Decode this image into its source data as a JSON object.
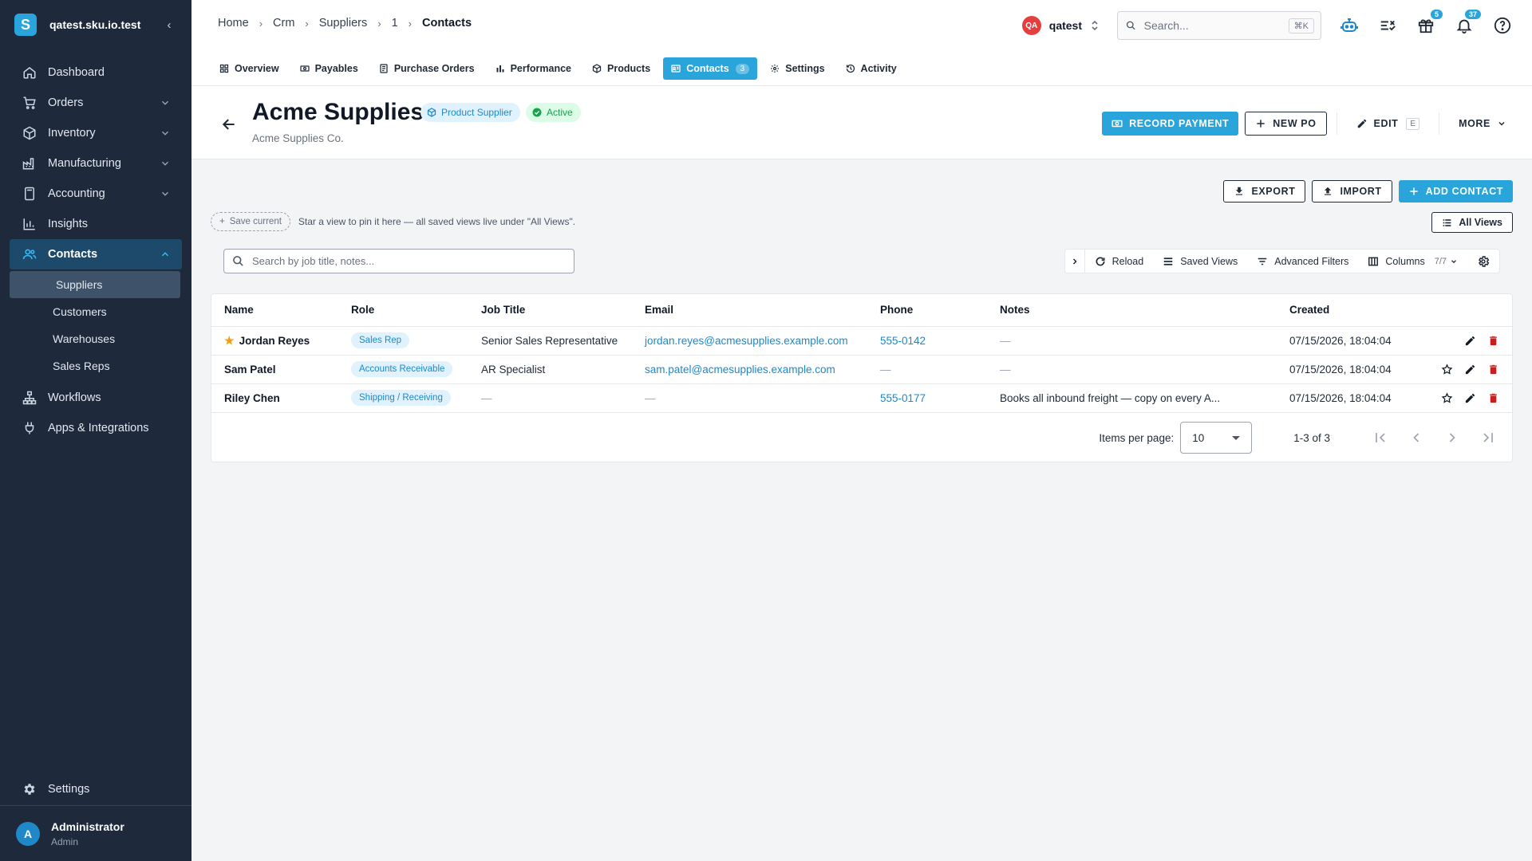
{
  "app": {
    "org_name": "qatest.sku.io.test",
    "logo_letter": "S",
    "brand_color": "#2aa5dc"
  },
  "sidebar": {
    "items": [
      {
        "label": "Dashboard",
        "icon": "home-icon"
      },
      {
        "label": "Orders",
        "icon": "cart-icon",
        "expandable": true
      },
      {
        "label": "Inventory",
        "icon": "box-icon",
        "expandable": true
      },
      {
        "label": "Manufacturing",
        "icon": "factory-icon",
        "expandable": true
      },
      {
        "label": "Accounting",
        "icon": "calculator-icon",
        "expandable": true
      },
      {
        "label": "Insights",
        "icon": "bar-chart-icon"
      },
      {
        "label": "Contacts",
        "icon": "people-icon",
        "expandable": true,
        "expanded": true,
        "active": true
      },
      {
        "label": "Workflows",
        "icon": "workflow-icon"
      },
      {
        "label": "Apps & Integrations",
        "icon": "plug-icon"
      }
    ],
    "contacts_sub": [
      {
        "label": "Suppliers",
        "active": true
      },
      {
        "label": "Customers"
      },
      {
        "label": "Warehouses"
      },
      {
        "label": "Sales Reps"
      }
    ],
    "settings_label": "Settings",
    "user": {
      "initial": "A",
      "name": "Administrator",
      "role": "Admin"
    }
  },
  "breadcrumb": [
    "Home",
    "Crm",
    "Suppliers",
    "1",
    "Contacts"
  ],
  "topbar": {
    "workspace_initials": "QA",
    "workspace_name": "qatest",
    "search_placeholder": "Search...",
    "search_shortcut": "⌘K",
    "gift_count": "5",
    "notification_count": "37"
  },
  "tabs": [
    {
      "label": "Overview",
      "icon": "grid-icon"
    },
    {
      "label": "Payables",
      "icon": "money-icon"
    },
    {
      "label": "Purchase Orders",
      "icon": "document-icon"
    },
    {
      "label": "Performance",
      "icon": "bar-chart-icon"
    },
    {
      "label": "Products",
      "icon": "cube-icon"
    },
    {
      "label": "Contacts",
      "icon": "contact-card-icon",
      "active": true,
      "count": "3"
    },
    {
      "label": "Settings",
      "icon": "gear-icon"
    },
    {
      "label": "Activity",
      "icon": "history-icon"
    }
  ],
  "supplier": {
    "name": "Acme Supplies",
    "legal_name": "Acme Supplies Co.",
    "type_badge": "Product Supplier",
    "status_badge": "Active"
  },
  "header_actions": {
    "record_payment": "RECORD PAYMENT",
    "new_po": "NEW PO",
    "edit": "EDIT",
    "edit_shortcut": "E",
    "more": "MORE"
  },
  "list_actions": {
    "export": "EXPORT",
    "import": "IMPORT",
    "add_contact": "ADD CONTACT"
  },
  "views": {
    "save_current": "Save current",
    "hint": "Star a view to pin it here — all saved views live under \"All Views\".",
    "all_views": "All Views"
  },
  "table_toolbar": {
    "search_placeholder": "Search by job title, notes...",
    "reload": "Reload",
    "saved_views": "Saved Views",
    "advanced_filters": "Advanced Filters",
    "columns": "Columns",
    "columns_count": "7/7"
  },
  "table": {
    "columns": [
      "Name",
      "Role",
      "Job Title",
      "Email",
      "Phone",
      "Notes",
      "Created"
    ],
    "rows": [
      {
        "name": "Jordan Reyes",
        "starred": true,
        "role": "Sales Rep",
        "job_title": "Senior Sales Representative",
        "email": "jordan.reyes@acmesupplies.example.com",
        "phone": "555-0142",
        "notes": "—",
        "created": "07/15/2026, 18:04:04"
      },
      {
        "name": "Sam Patel",
        "starred": false,
        "role": "Accounts Receivable",
        "job_title": "AR Specialist",
        "email": "sam.patel@acmesupplies.example.com",
        "phone": "—",
        "notes": "—",
        "created": "07/15/2026, 18:04:04"
      },
      {
        "name": "Riley Chen",
        "starred": false,
        "role": "Shipping / Receiving",
        "job_title": "—",
        "email": "—",
        "phone": "555-0177",
        "notes": "Books all inbound freight — copy on every A...",
        "created": "07/15/2026, 18:04:04"
      }
    ]
  },
  "pagination": {
    "items_per_page_label": "Items per page:",
    "items_per_page": "10",
    "range": "1-3 of 3"
  }
}
